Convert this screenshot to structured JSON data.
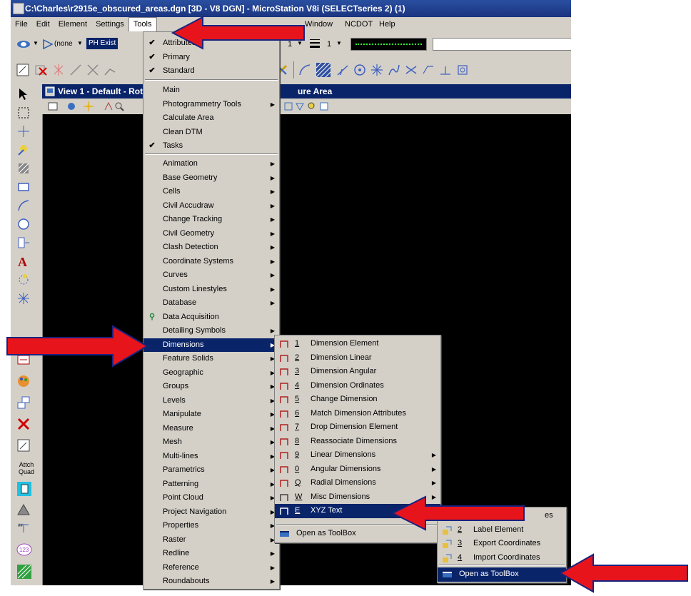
{
  "window": {
    "title": "C:\\Charles\\r2915e_obscured_areas.dgn [3D - V8 DGN] - MicroStation V8i (SELECTseries 2) (1)"
  },
  "menubar": [
    "File",
    "Edit",
    "Element",
    "Settings",
    "Tools",
    "Window",
    "NCDOT",
    "Help"
  ],
  "toolbar": {
    "level_combo": "(none",
    "text_style": "PH Exist",
    "line_weight": "1",
    "line_style": "1"
  },
  "view": {
    "title_left": "View 1 - Default - Rot",
    "title_right": "ure Area"
  },
  "left_tools": {
    "attach_label_1": "Attch",
    "attach_label_2": "Quad"
  },
  "tools_menu": {
    "top_items": [
      {
        "label": "Attributes",
        "checked": true
      },
      {
        "label": "Primary",
        "checked": true
      },
      {
        "label": "Standard",
        "checked": true
      }
    ],
    "mid_items": [
      {
        "label": "Main"
      },
      {
        "label": "Photogrammetry Tools",
        "submenu": true
      },
      {
        "label": "Calculate Area"
      },
      {
        "label": "Clean DTM"
      },
      {
        "label": "Tasks",
        "checked": true
      }
    ],
    "items": [
      {
        "label": "Animation",
        "submenu": true
      },
      {
        "label": "Base Geometry",
        "submenu": true
      },
      {
        "label": "Cells",
        "submenu": true
      },
      {
        "label": "Civil Accudraw",
        "submenu": true
      },
      {
        "label": "Change Tracking",
        "submenu": true
      },
      {
        "label": "Civil Geometry",
        "submenu": true
      },
      {
        "label": "Clash Detection",
        "submenu": true
      },
      {
        "label": "Coordinate Systems",
        "submenu": true
      },
      {
        "label": "Curves",
        "submenu": true
      },
      {
        "label": "Custom Linestyles",
        "submenu": true
      },
      {
        "label": "Database",
        "submenu": true
      },
      {
        "label": "Data Acquisition",
        "submenu": false
      },
      {
        "label": "Detailing Symbols",
        "submenu": true
      },
      {
        "label": "Dimensions",
        "submenu": true,
        "highlighted": true
      },
      {
        "label": "Feature Solids",
        "submenu": true
      },
      {
        "label": "Geographic",
        "submenu": true
      },
      {
        "label": "Groups",
        "submenu": true
      },
      {
        "label": "Levels",
        "submenu": true
      },
      {
        "label": "Manipulate",
        "submenu": true
      },
      {
        "label": "Measure",
        "submenu": true
      },
      {
        "label": "Mesh",
        "submenu": true
      },
      {
        "label": "Multi-lines",
        "submenu": true
      },
      {
        "label": "Parametrics",
        "submenu": true
      },
      {
        "label": "Patterning",
        "submenu": true
      },
      {
        "label": "Point Cloud",
        "submenu": true
      },
      {
        "label": "Project Navigation",
        "submenu": true
      },
      {
        "label": "Properties",
        "submenu": true
      },
      {
        "label": "Raster",
        "submenu": true
      },
      {
        "label": "Redline",
        "submenu": true
      },
      {
        "label": "Reference",
        "submenu": true
      },
      {
        "label": "Roundabouts",
        "submenu": true
      }
    ]
  },
  "dimensions_menu": {
    "items": [
      {
        "num": "1",
        "label": "Dimension Element"
      },
      {
        "num": "2",
        "label": "Dimension Linear"
      },
      {
        "num": "3",
        "label": "Dimension Angular"
      },
      {
        "num": "4",
        "label": "Dimension Ordinates"
      },
      {
        "num": "5",
        "label": "Change Dimension"
      },
      {
        "num": "6",
        "label": "Match Dimension Attributes"
      },
      {
        "num": "7",
        "label": "Drop Dimension Element"
      },
      {
        "num": "8",
        "label": "Reassociate Dimensions"
      },
      {
        "num": "9",
        "label": "Linear Dimensions",
        "submenu": true
      },
      {
        "num": "0",
        "label": "Angular Dimensions",
        "submenu": true
      },
      {
        "num": "Q",
        "label": "Radial Dimensions",
        "submenu": true
      },
      {
        "num": "W",
        "label": "Misc Dimensions",
        "submenu": true
      },
      {
        "num": "E",
        "label": "XYZ Text",
        "submenu": true,
        "highlighted": true
      }
    ],
    "open_toolbox": "Open as ToolBox"
  },
  "xyz_menu": {
    "items": [
      {
        "num": "1",
        "label": "es"
      },
      {
        "num": "2",
        "label": "Label Element"
      },
      {
        "num": "3",
        "label": "Export Coordinates"
      },
      {
        "num": "4",
        "label": "Import Coordinates"
      }
    ],
    "open_toolbox": "Open as ToolBox"
  },
  "colors": {
    "highlight": "#0a246a",
    "menu_bg": "#d4d0c8",
    "arrow_red": "#e8141c",
    "arrow_outline": "#1a237e"
  }
}
